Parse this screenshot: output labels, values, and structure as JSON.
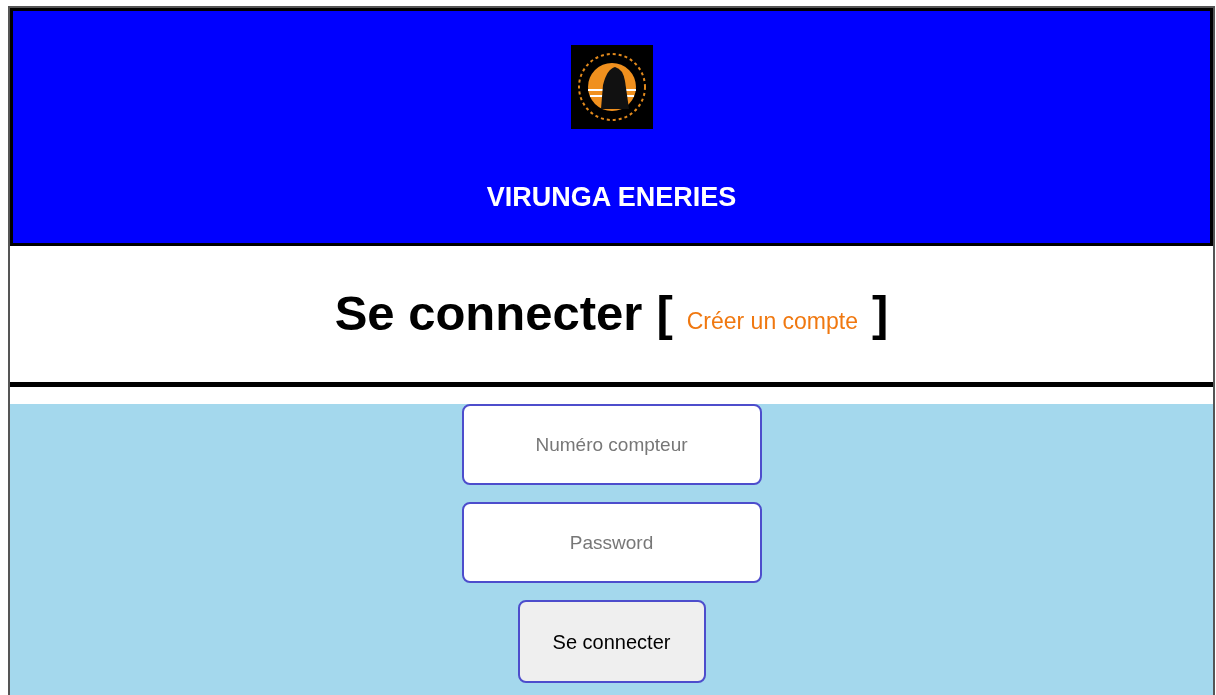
{
  "header": {
    "title": "VIRUNGA ENERIES"
  },
  "heading": {
    "title": "Se connecter",
    "open_bracket": "[",
    "link": "Créer un compte",
    "close_bracket": "]"
  },
  "form": {
    "fields": [
      {
        "placeholder": "Numéro compteur"
      },
      {
        "placeholder": "Password"
      }
    ],
    "button": "Se connecter"
  }
}
